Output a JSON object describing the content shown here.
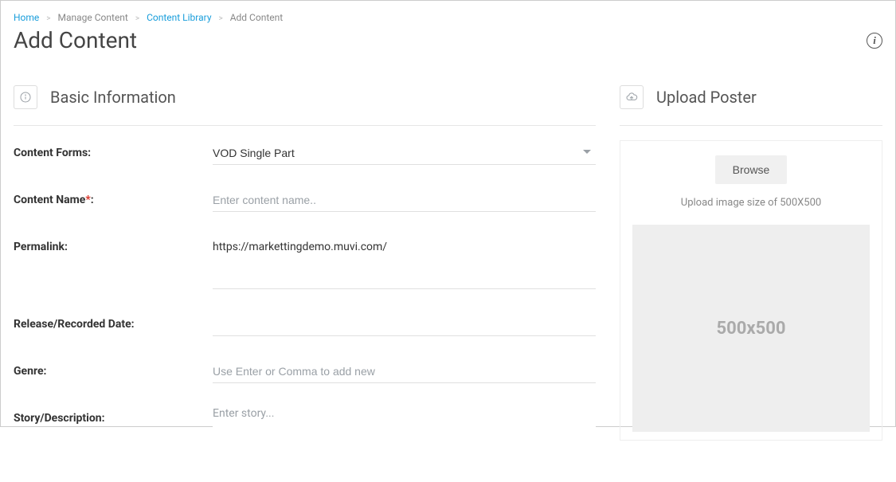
{
  "breadcrumb": {
    "home": "Home",
    "manage": "Manage Content",
    "library": "Content Library",
    "current": "Add Content"
  },
  "page_title": "Add Content",
  "sections": {
    "basic": {
      "title": "Basic Information"
    },
    "upload": {
      "title": "Upload Poster"
    }
  },
  "form": {
    "content_forms": {
      "label": "Content Forms:",
      "value": "VOD Single Part"
    },
    "content_name": {
      "label": "Content Name",
      "req": "*",
      "colon": ":",
      "placeholder": "Enter content name.."
    },
    "permalink": {
      "label": "Permalink:",
      "prefix": "https://markettingdemo.muvi.com/",
      "value": ""
    },
    "release_date": {
      "label": "Release/Recorded Date:",
      "value": ""
    },
    "genre": {
      "label": "Genre:",
      "placeholder": "Use Enter or Comma to add new"
    },
    "story": {
      "label": "Story/Description:",
      "placeholder": "Enter story..."
    }
  },
  "upload": {
    "browse": "Browse",
    "hint": "Upload image size of 500X500",
    "placeholder_text": "500x500"
  }
}
